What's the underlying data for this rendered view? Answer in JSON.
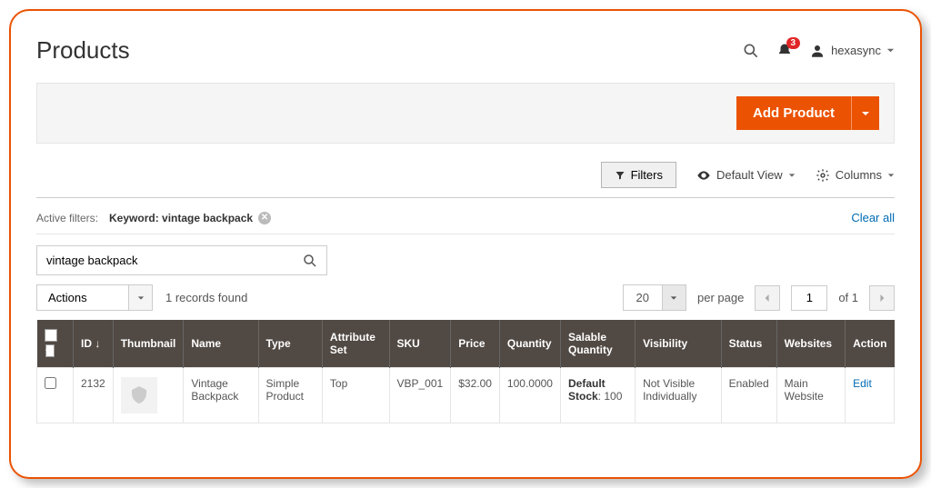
{
  "header": {
    "title": "Products",
    "notification_count": "3",
    "username": "hexasync"
  },
  "toolbar": {
    "add_product_label": "Add Product"
  },
  "controls": {
    "filters_label": "Filters",
    "default_view_label": "Default View",
    "columns_label": "Columns"
  },
  "filters": {
    "active_label": "Active filters:",
    "chip_label": "Keyword: vintage backpack",
    "clear_label": "Clear all",
    "search_value": "vintage backpack"
  },
  "grid": {
    "actions_label": "Actions",
    "records_found": "1 records found",
    "per_page_value": "20",
    "per_page_label": "per page",
    "page_value": "1",
    "page_of": "of 1"
  },
  "columns": {
    "id": "ID",
    "thumbnail": "Thumbnail",
    "name": "Name",
    "type": "Type",
    "attribute_set": "Attribute Set",
    "sku": "SKU",
    "price": "Price",
    "quantity": "Quantity",
    "salable": "Salable Quantity",
    "visibility": "Visibility",
    "status": "Status",
    "websites": "Websites",
    "action": "Action"
  },
  "rows": [
    {
      "id": "2132",
      "name": "Vintage Backpack",
      "type": "Simple Product",
      "attribute_set": "Top",
      "sku": "VBP_001",
      "price": "$32.00",
      "quantity": "100.0000",
      "salable_label": "Default Stock",
      "salable_value": "100",
      "visibility": "Not Visible Individually",
      "status": "Enabled",
      "websites": "Main Website",
      "action": "Edit"
    }
  ]
}
